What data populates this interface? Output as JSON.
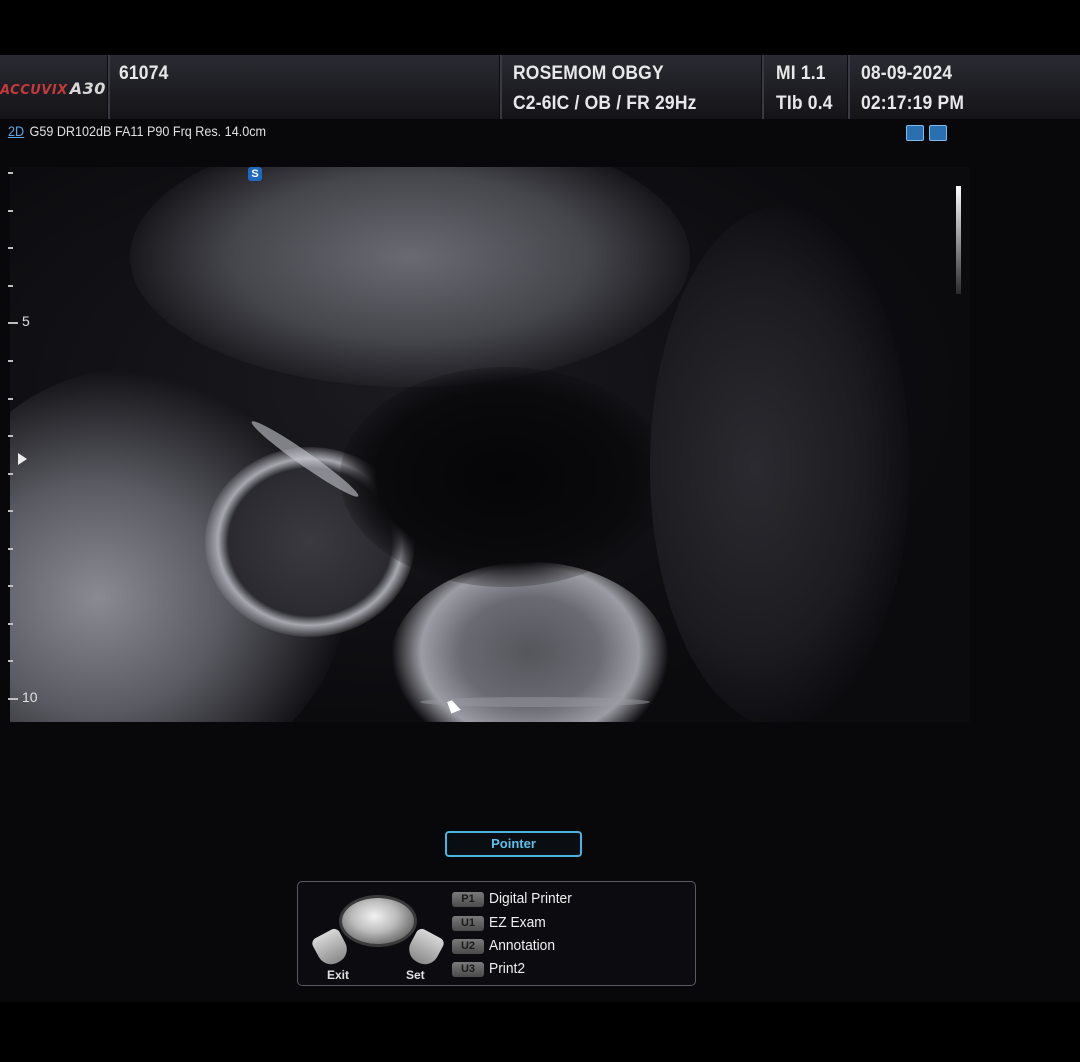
{
  "header": {
    "logo_brand": "ACCUVIX",
    "logo_model": "A30",
    "patient_id": "61074",
    "institution": "ROSEMOM OBGY",
    "probe_preset": "C2-6IC / OB / FR 29Hz",
    "mi": "MI  1.1",
    "tib": "TIb 0.4",
    "date": "08-09-2024",
    "time": "02:17:19 PM"
  },
  "status": {
    "mode": "2D",
    "params": "G59 DR102dB FA11 P90 Frq Res. 14.0cm"
  },
  "top_icons": [
    "harmonic-icon",
    "image-icon"
  ],
  "image": {
    "scan_marker": "S",
    "depth_labels": [
      "5",
      "10"
    ]
  },
  "pointer_button": {
    "label": "Pointer"
  },
  "trackball": {
    "exit_label": "Exit",
    "set_label": "Set",
    "keys": [
      {
        "badge": "P1",
        "label": "Digital Printer"
      },
      {
        "badge": "U1",
        "label": "EZ Exam"
      },
      {
        "badge": "U2",
        "label": "Annotation"
      },
      {
        "badge": "U3",
        "label": "Print2"
      }
    ]
  }
}
